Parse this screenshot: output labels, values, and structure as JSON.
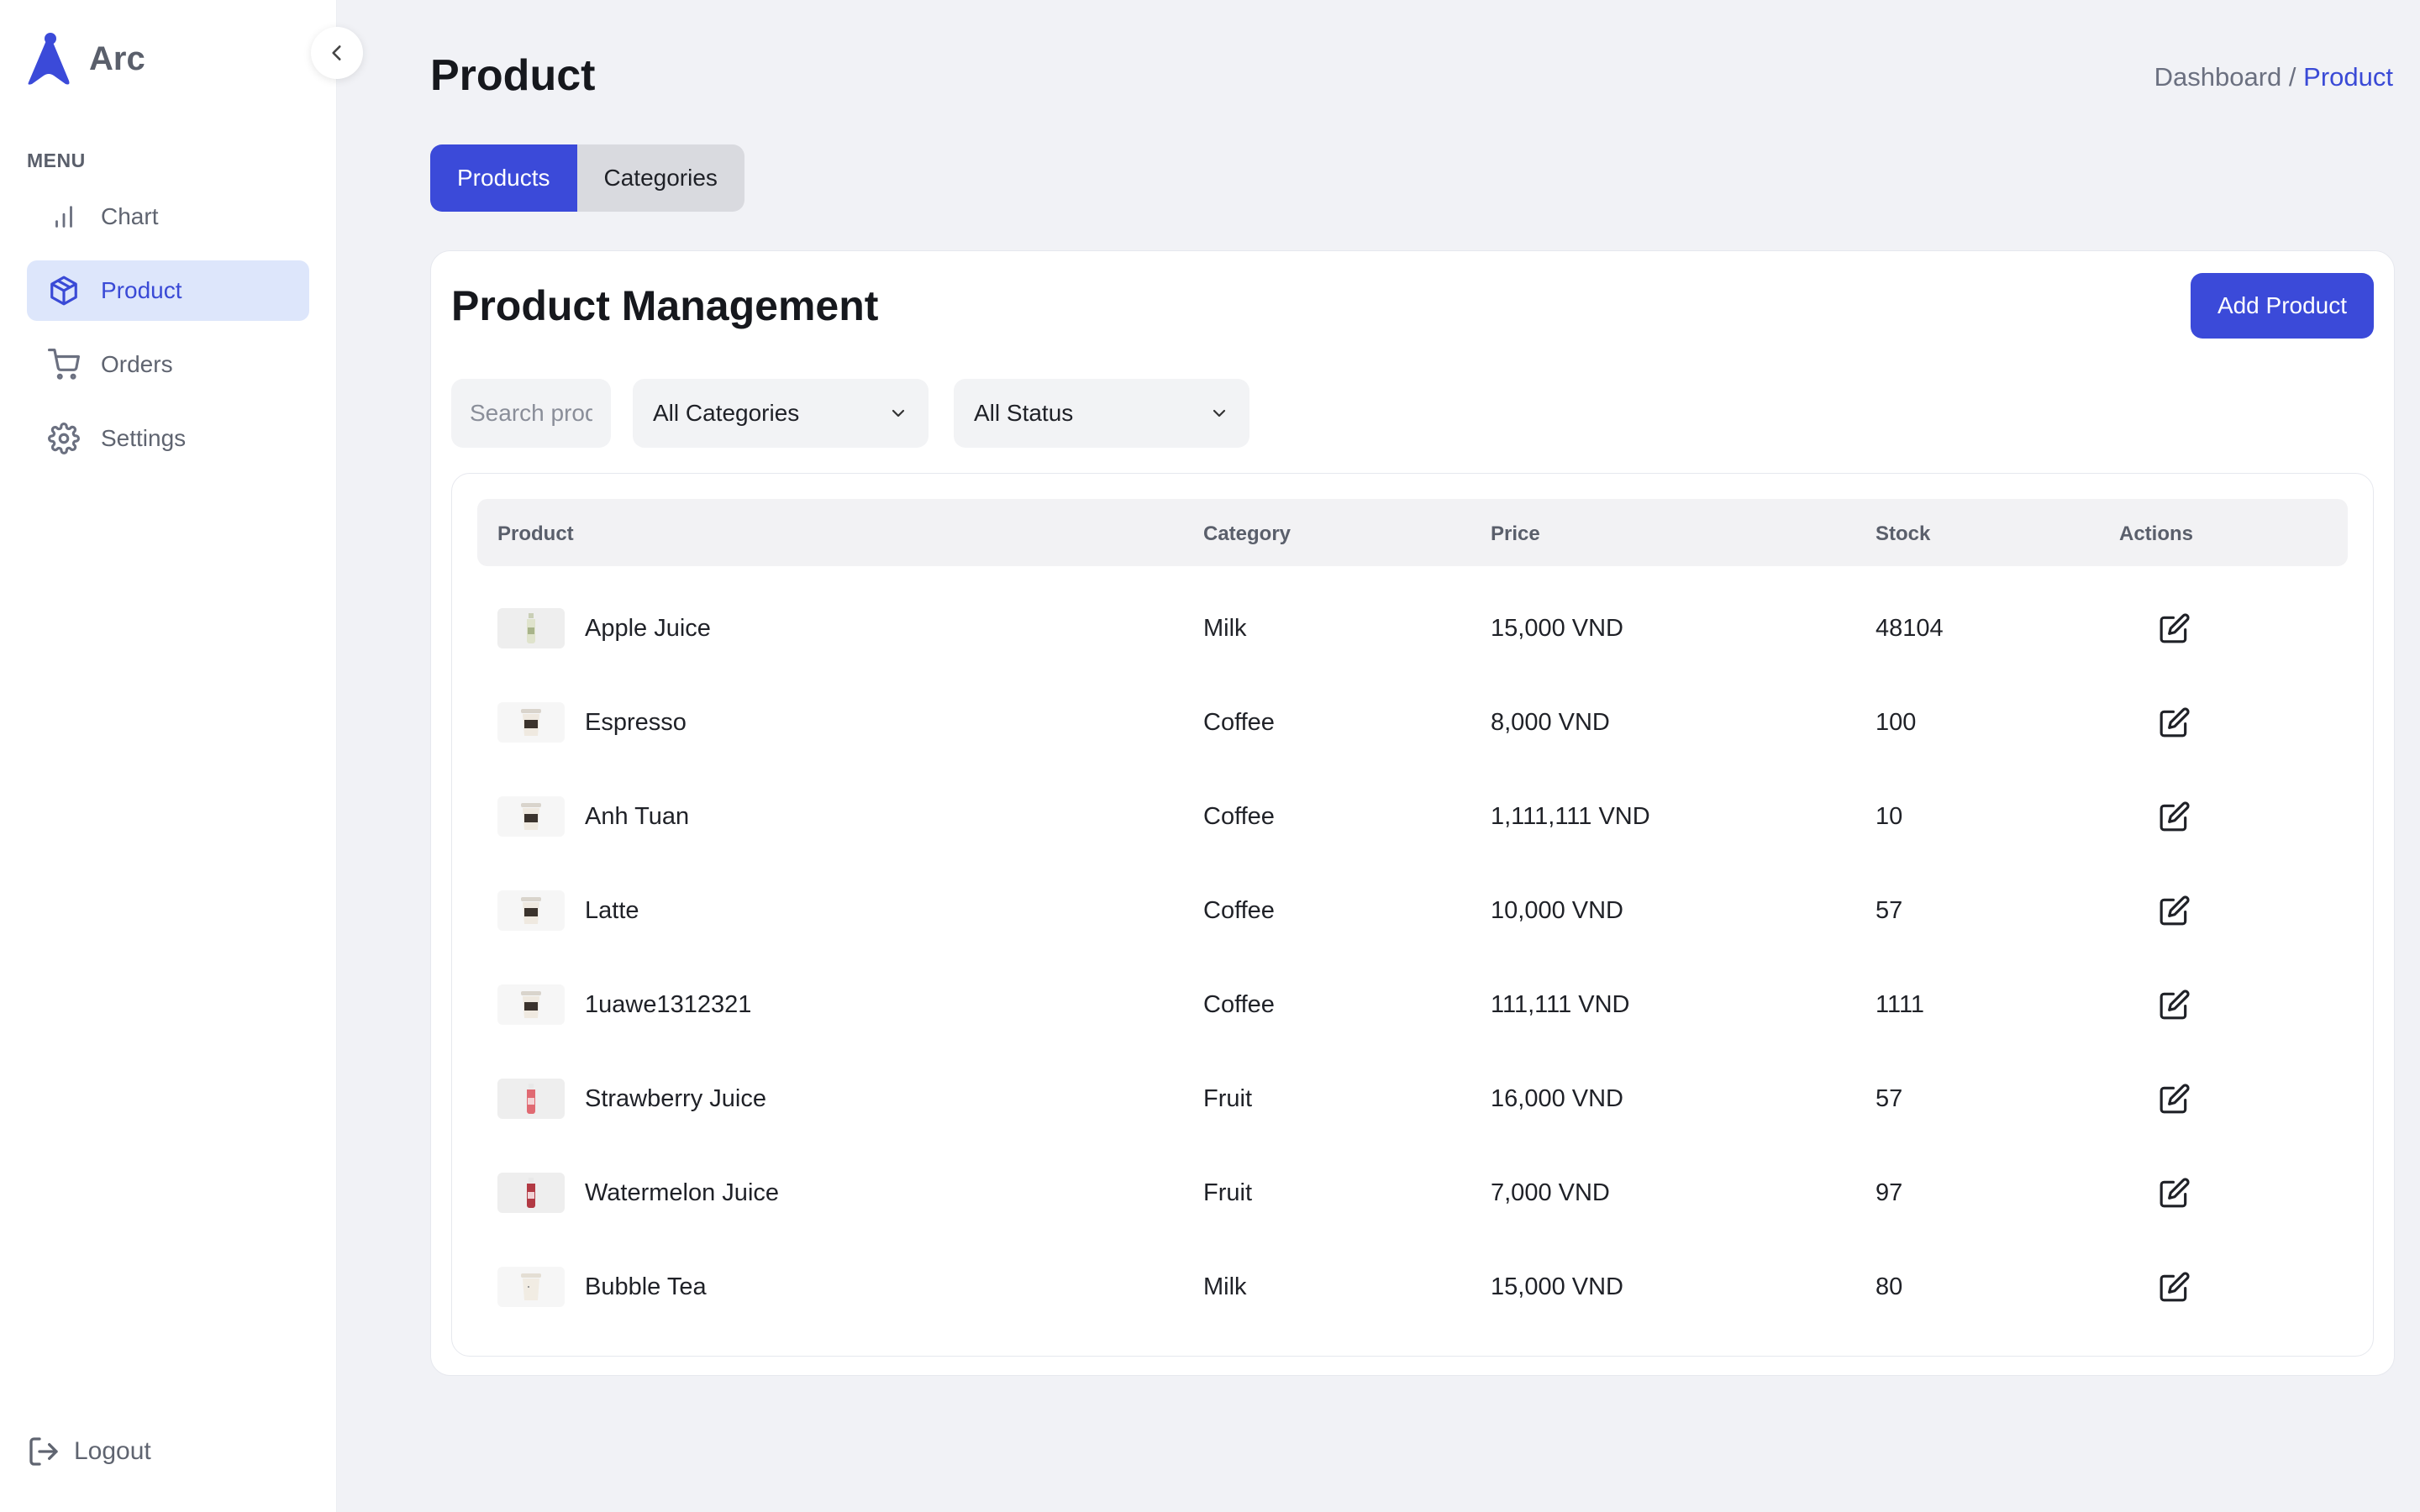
{
  "brand": {
    "name": "Arc",
    "logo_color": "#3b4ad9"
  },
  "sidebar": {
    "menu_title": "MENU",
    "items": [
      {
        "label": "Chart",
        "icon": "bar-chart-icon",
        "active": false
      },
      {
        "label": "Product",
        "icon": "box-icon",
        "active": true
      },
      {
        "label": "Orders",
        "icon": "cart-icon",
        "active": false
      },
      {
        "label": "Settings",
        "icon": "gear-icon",
        "active": false
      }
    ],
    "logout_label": "Logout"
  },
  "header": {
    "title": "Product",
    "breadcrumb": {
      "parent": "Dashboard /",
      "current": "Product"
    }
  },
  "tabs": [
    {
      "label": "Products",
      "active": true
    },
    {
      "label": "Categories",
      "active": false
    }
  ],
  "card": {
    "title": "Product Management",
    "add_button_label": "Add Product",
    "search_placeholder": "Search products...",
    "category_filter": "All Categories",
    "status_filter": "All Status"
  },
  "table": {
    "columns": [
      "Product",
      "Category",
      "Price",
      "Stock",
      "Actions"
    ],
    "rows": [
      {
        "name": "Apple Juice",
        "category": "Milk",
        "price": "15,000 VND",
        "stock": "48104",
        "thumb": "bottle-green"
      },
      {
        "name": "Espresso",
        "category": "Coffee",
        "price": "8,000 VND",
        "stock": "100",
        "thumb": "cup"
      },
      {
        "name": "Anh Tuan",
        "category": "Coffee",
        "price": "1,111,111 VND",
        "stock": "10",
        "thumb": "cup"
      },
      {
        "name": "Latte",
        "category": "Coffee",
        "price": "10,000 VND",
        "stock": "57",
        "thumb": "cup"
      },
      {
        "name": "1uawe1312321",
        "category": "Coffee",
        "price": "111,111 VND",
        "stock": "1111",
        "thumb": "cup"
      },
      {
        "name": "Strawberry Juice",
        "category": "Fruit",
        "price": "16,000 VND",
        "stock": "57",
        "thumb": "bottle-red"
      },
      {
        "name": "Watermelon Juice",
        "category": "Fruit",
        "price": "7,000 VND",
        "stock": "97",
        "thumb": "bottle-darkred"
      },
      {
        "name": "Bubble Tea",
        "category": "Milk",
        "price": "15,000 VND",
        "stock": "80",
        "thumb": "cup-light"
      }
    ]
  },
  "colors": {
    "accent": "#3b4ad9",
    "active_nav_bg": "#dde6fb",
    "page_bg": "#f1f2f6"
  }
}
